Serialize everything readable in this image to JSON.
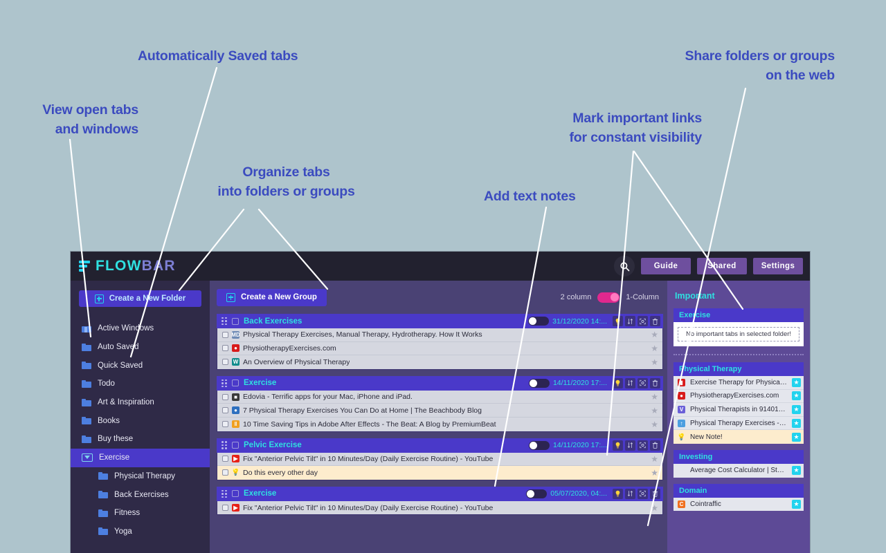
{
  "callouts": [
    {
      "id": "view-open-tabs",
      "text": "View open tabs\nand windows"
    },
    {
      "id": "auto-saved-tabs",
      "text": "Automatically Saved tabs"
    },
    {
      "id": "organize-tabs",
      "text": "Organize tabs\ninto folders or groups"
    },
    {
      "id": "add-text-notes",
      "text": "Add text notes"
    },
    {
      "id": "mark-important",
      "text": "Mark important links\nfor constant visibility"
    },
    {
      "id": "share-folders",
      "text": "Share folders or groups\non the web"
    }
  ],
  "app": {
    "logo": {
      "flow": "FLOW",
      "bar": "BAR"
    },
    "topbar": {
      "search_icon": "search-icon",
      "buttons": [
        "Guide",
        "Shared",
        "Settings"
      ]
    },
    "sidebar": {
      "create_folder_label": "Create a New Folder",
      "help_badge": "?",
      "items": [
        {
          "label": "Active Windows",
          "icon": "window-icon",
          "indent": false,
          "active": false,
          "badge": true
        },
        {
          "label": "Auto Saved",
          "icon": "folder-icon",
          "indent": false,
          "active": false
        },
        {
          "label": "Quick Saved",
          "icon": "folder-icon",
          "indent": false,
          "active": false
        },
        {
          "label": "Todo",
          "icon": "folder-icon",
          "indent": false,
          "active": false
        },
        {
          "label": "Art & Inspiration",
          "icon": "folder-icon",
          "indent": false,
          "active": false
        },
        {
          "label": "Books",
          "icon": "folder-icon",
          "indent": false,
          "active": false
        },
        {
          "label": "Buy these",
          "icon": "folder-icon",
          "indent": false,
          "active": false
        },
        {
          "label": "Exercise",
          "icon": "folder-open-icon",
          "indent": false,
          "active": true
        },
        {
          "label": "Physical Therapy",
          "icon": "folder-icon",
          "indent": true,
          "active": false
        },
        {
          "label": "Back Exercises",
          "icon": "folder-icon",
          "indent": true,
          "active": false
        },
        {
          "label": "Fitness",
          "icon": "folder-icon",
          "indent": true,
          "active": false
        },
        {
          "label": "Yoga",
          "icon": "folder-icon",
          "indent": true,
          "active": false
        }
      ]
    },
    "main": {
      "create_group_label": "Create a New Group",
      "column_toggle": {
        "left_label": "2 column",
        "right_label": "1-Column",
        "state": "1-Column"
      },
      "group_actions": [
        "note-icon",
        "sort-icon",
        "share-icon",
        "trash-icon"
      ],
      "groups": [
        {
          "name": "Back Exercises",
          "date": "31/12/2020 14:...",
          "tabs": [
            {
              "title": "Physical Therapy Exercises, Manual Therapy, Hydrotherapy. How It Works",
              "favicon": "MD",
              "favcolor": "#6e8ab5",
              "note": false
            },
            {
              "title": "PhysiotherapyExercises.com",
              "favicon": "●",
              "favcolor": "#d81b1b",
              "note": false
            },
            {
              "title": "An Overview of Physical Therapy",
              "favicon": "W",
              "favcolor": "#0f8c8c",
              "note": false
            }
          ]
        },
        {
          "name": "Exercise",
          "date": "14/11/2020 17:...",
          "tabs": [
            {
              "title": "Edovia - Terrific apps for your Mac, iPhone and iPad.",
              "favicon": "■",
              "favcolor": "#3a3a3a",
              "note": false
            },
            {
              "title": "7 Physical Therapy Exercises You Can Do at Home | The Beachbody Blog",
              "favicon": "●",
              "favcolor": "#2d6fbf",
              "note": false
            },
            {
              "title": "10 Time Saving Tips in Adobe After Effects - The Beat: A Blog by PremiumBeat",
              "favicon": "‖",
              "favcolor": "#f0a020",
              "note": false
            }
          ]
        },
        {
          "name": "Pelvic Exercise",
          "date": "14/11/2020 17:...",
          "tabs": [
            {
              "title": "Fix \"Anterior Pelvic Tilt\" in 10 Minutes/Day (Daily Exercise Routine) - YouTube",
              "favicon": "▶",
              "favcolor": "#e62117",
              "note": false
            },
            {
              "title": "Do this every other day",
              "favicon": "💡",
              "favcolor": "transparent",
              "note": true
            }
          ]
        },
        {
          "name": "Exercise",
          "date": "05/07/2020, 04:...",
          "tabs": [
            {
              "title": "Fix \"Anterior Pelvic Tilt\" in 10 Minutes/Day (Daily Exercise Routine) - YouTube",
              "favicon": "▶",
              "favcolor": "#e62117",
              "note": false
            }
          ]
        }
      ]
    },
    "important_panel": {
      "title": "Important",
      "empty_message": "No important tabs in selected folder!",
      "sections": [
        {
          "name": "Exercise",
          "empty": true,
          "items": []
        },
        {
          "name": "Physical Therapy",
          "empty": false,
          "items": [
            {
              "title": "Exercise Therapy for Physical T...",
              "favicon": "▮",
              "favcolor": "#d81b1b",
              "note": false
            },
            {
              "title": "PhysiotherapyExercises.com",
              "favicon": "●",
              "favcolor": "#d81b1b",
              "note": false
            },
            {
              "title": "Physical Therapists in 91401 - V...",
              "favicon": "V",
              "favcolor": "#6a5fd8",
              "note": false
            },
            {
              "title": "Physical Therapy Exercises - Ph...",
              "favicon": "↑",
              "favcolor": "#4d9fe0",
              "note": false
            },
            {
              "title": "New Note!",
              "favicon": "💡",
              "favcolor": "transparent",
              "note": true
            }
          ]
        },
        {
          "name": "Investing",
          "empty": false,
          "items": [
            {
              "title": "Average Cost Calculator | Stock...",
              "favicon": "",
              "favcolor": "transparent",
              "note": false
            }
          ]
        },
        {
          "name": "Domain",
          "empty": false,
          "items": [
            {
              "title": "Cointraffic",
              "favicon": "C",
              "favcolor": "#f07020",
              "note": false
            }
          ]
        }
      ],
      "star_glyph": "★"
    }
  },
  "colors": {
    "page_bg": "#aec4cc",
    "callout_text": "#3b4bbf",
    "leader_line": "#ffffff",
    "topbar_bg": "#22212f",
    "sidebar_bg": "#2f2a47",
    "main_bg": "#4a4274",
    "right_panel_bg": "#5d4a96",
    "accent_blue": "#4a39c9",
    "accent_cyan": "#2fe0e0",
    "toggle_pink": "#e0288e",
    "note_bg": "#fdeccd"
  }
}
